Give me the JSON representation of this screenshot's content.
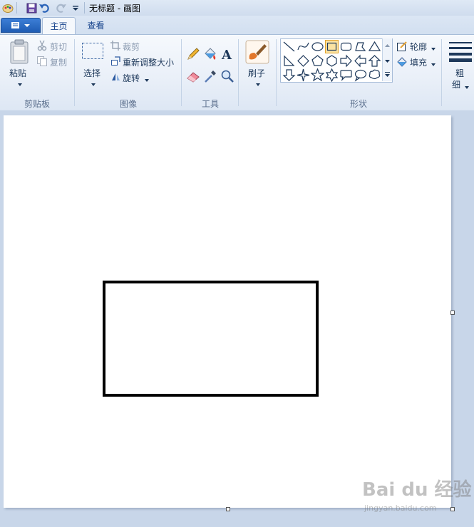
{
  "window": {
    "title": "无标题 - 画图"
  },
  "quick_access": {
    "icons": [
      "paint-app-icon",
      "save-icon",
      "undo-icon",
      "redo-icon",
      "customize-qat-icon"
    ]
  },
  "tabs": [
    {
      "label": "主页",
      "active": true
    },
    {
      "label": "查看",
      "active": false
    }
  ],
  "ribbon": {
    "clipboard": {
      "paste_label": "粘贴",
      "cut_label": "剪切",
      "copy_label": "复制",
      "group_label": "剪贴板"
    },
    "image": {
      "select_label": "选择",
      "crop_label": "裁剪",
      "resize_label": "重新调整大小",
      "rotate_label": "旋转",
      "group_label": "图像"
    },
    "tools": {
      "group_label": "工具",
      "icons": [
        "pencil-icon",
        "fill-icon",
        "text-icon",
        "eraser-icon",
        "color-picker-icon",
        "magnifier-icon"
      ]
    },
    "brushes": {
      "label": "刷子"
    },
    "shapes": {
      "group_label": "形状",
      "outline_label": "轮廓",
      "fill_label": "填充",
      "selected_shape": "rectangle"
    },
    "size": {
      "label_line1": "粗",
      "label_line2": "细"
    }
  },
  "colors": {
    "accent": "#15428b",
    "selection_highlight": "#fbe3a2",
    "canvas": "#ffffff",
    "shape_stroke": "#000000"
  },
  "watermark": {
    "logo": "Bai du 经验",
    "url": "jingyan.baidu.com"
  }
}
